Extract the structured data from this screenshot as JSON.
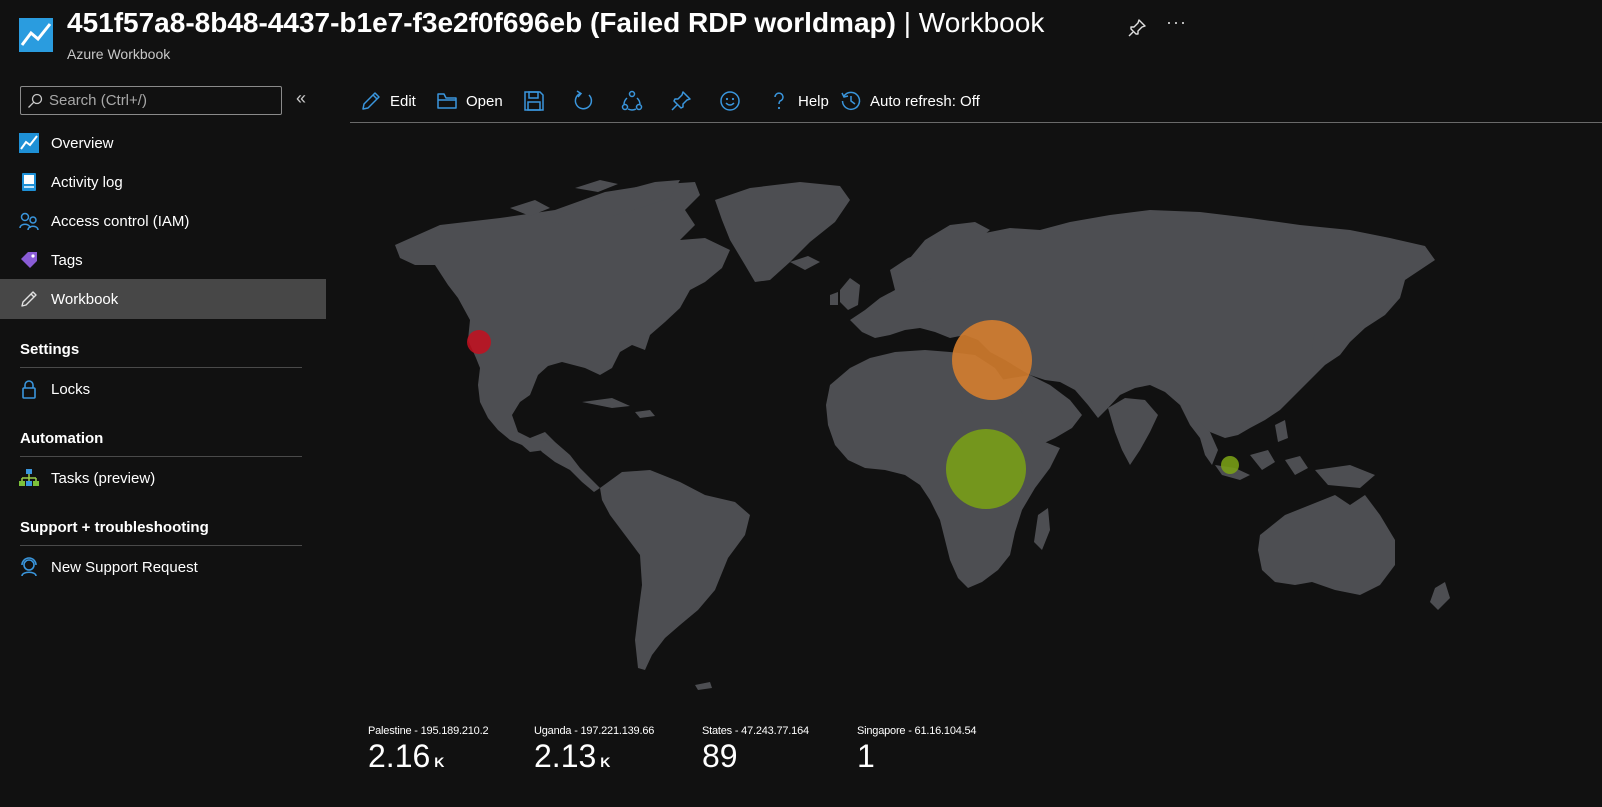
{
  "header": {
    "title_main": "451f57a8-8b48-4437-b1e7-f3e2f0f696eb (Failed RDP worldmap)",
    "title_sep": " | Workbook",
    "subtitle": "Azure Workbook",
    "icon": "workbook-app-icon",
    "more_label": "···"
  },
  "sidebar": {
    "search_placeholder": "Search (Ctrl+/)",
    "collapse_label": "«",
    "items": [
      {
        "label": "Overview",
        "icon": "overview-icon"
      },
      {
        "label": "Activity log",
        "icon": "activity-log-icon"
      },
      {
        "label": "Access control (IAM)",
        "icon": "iam-icon"
      },
      {
        "label": "Tags",
        "icon": "tag-icon"
      },
      {
        "label": "Workbook",
        "icon": "pencil-icon",
        "active": true
      }
    ],
    "sections": [
      {
        "title": "Settings",
        "items": [
          {
            "label": "Locks",
            "icon": "lock-icon"
          }
        ]
      },
      {
        "title": "Automation",
        "items": [
          {
            "label": "Tasks (preview)",
            "icon": "tasks-icon"
          }
        ]
      },
      {
        "title": "Support + troubleshooting",
        "items": [
          {
            "label": "New Support Request",
            "icon": "support-icon"
          }
        ]
      }
    ]
  },
  "toolbar": {
    "edit": "Edit",
    "open": "Open",
    "help": "Help",
    "auto_refresh": "Auto refresh: Off"
  },
  "map": {
    "land_color": "#4d4e52",
    "bubbles": [
      {
        "name": "States",
        "color": "#c50f1f"
      },
      {
        "name": "Palestine",
        "color": "#d87f2e"
      },
      {
        "name": "Uganda",
        "color": "#7aa116"
      },
      {
        "name": "Singapore",
        "color": "#7aa116"
      }
    ]
  },
  "tiles": [
    {
      "label": "Palestine - 195.189.210.2",
      "value": "2.16",
      "unit": "K"
    },
    {
      "label": "Uganda - 197.221.139.66",
      "value": "2.13",
      "unit": "K"
    },
    {
      "label": "States - 47.243.77.164",
      "value": "89",
      "unit": ""
    },
    {
      "label": "Singapore - 61.16.104.54",
      "value": "1",
      "unit": ""
    }
  ],
  "colors": {
    "background": "#111111",
    "accent": "#3a96dd",
    "active_nav": "#474747"
  }
}
